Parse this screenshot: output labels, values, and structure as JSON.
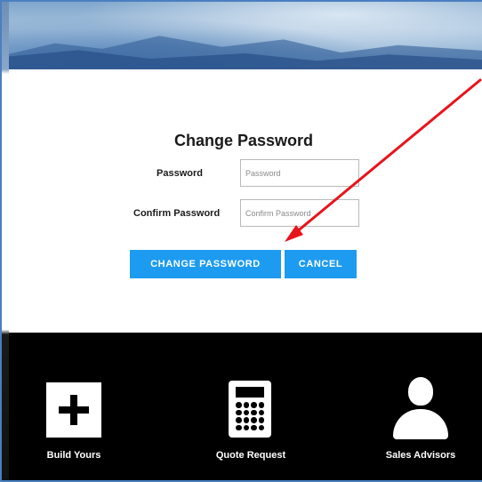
{
  "form": {
    "title": "Change Password",
    "password_label": "Password",
    "password_placeholder": "Password",
    "confirm_label": "Confirm Password",
    "confirm_placeholder": "Confirm Password"
  },
  "buttons": {
    "change_password": "CHANGE PASSWORD",
    "cancel": "CANCEL"
  },
  "footer": {
    "items": [
      {
        "label": "Build Yours",
        "icon": "plus-icon"
      },
      {
        "label": "Quote Request",
        "icon": "calculator-icon"
      },
      {
        "label": "Sales Advisors",
        "icon": "user-icon"
      }
    ]
  },
  "colors": {
    "button": "#1d9bf0",
    "footer_background": "#000000",
    "annotation_arrow": "#e8141b"
  }
}
